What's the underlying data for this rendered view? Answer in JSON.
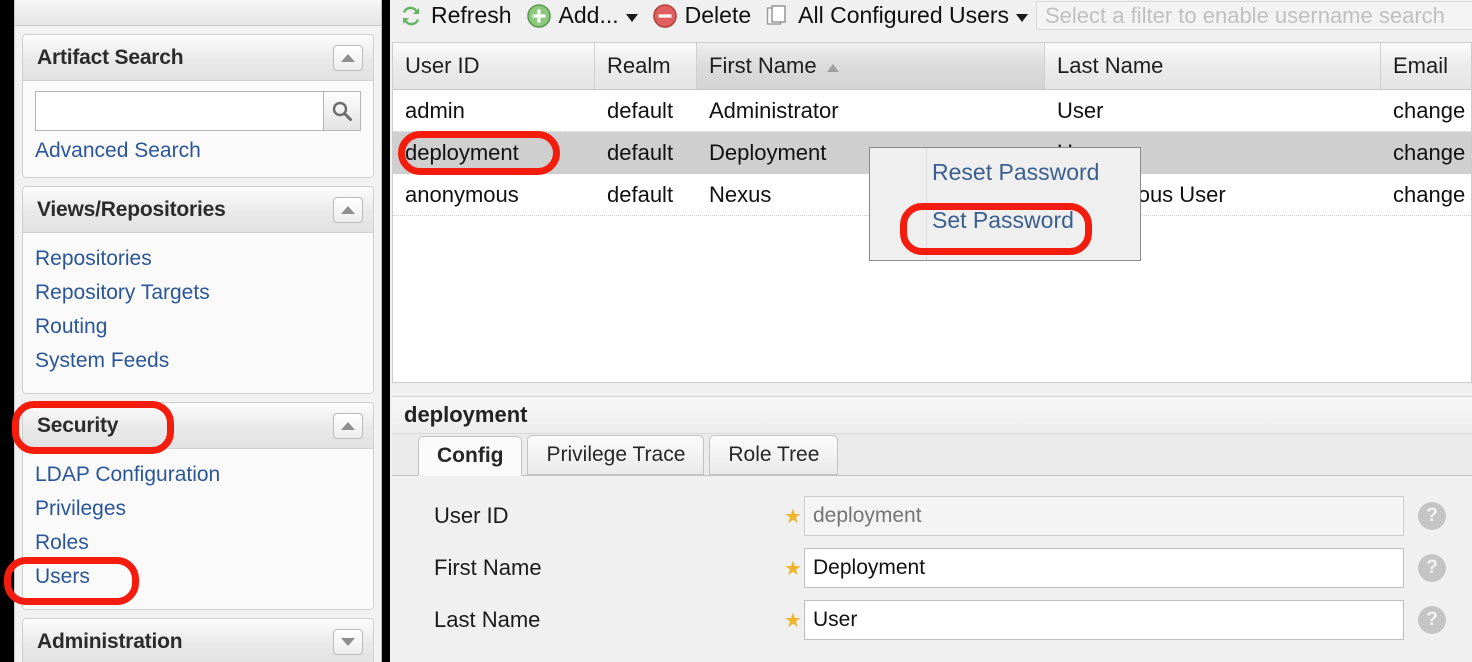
{
  "sidebar": {
    "panels": [
      {
        "title": "Artifact Search",
        "toggle_icon": "chevron-up-icon",
        "search_value": "",
        "search_placeholder": "",
        "search_icon": "magnifier-icon",
        "advanced_link": "Advanced Search"
      },
      {
        "title": "Views/Repositories",
        "toggle_icon": "chevron-up-icon",
        "links": [
          "Repositories",
          "Repository Targets",
          "Routing",
          "System Feeds"
        ]
      },
      {
        "title": "Security",
        "toggle_icon": "chevron-up-icon",
        "links": [
          "LDAP Configuration",
          "Privileges",
          "Roles",
          "Users"
        ]
      },
      {
        "title": "Administration",
        "toggle_icon": "chevron-down-icon",
        "links": []
      }
    ]
  },
  "toolbar": {
    "refresh_label": "Refresh",
    "refresh_icon": "refresh-icon",
    "add_label": "Add...",
    "add_icon": "add-circle-icon",
    "add_caret_icon": "caret-down-icon",
    "delete_label": "Delete",
    "delete_icon": "delete-circle-icon",
    "filter_label": "All Configured Users",
    "filter_icon": "pages-icon",
    "filter_caret_icon": "caret-down-icon",
    "search_value": "",
    "search_placeholder": "Select a filter to enable username search"
  },
  "grid": {
    "columns": [
      {
        "label": "User ID",
        "sorted": false
      },
      {
        "label": "Realm",
        "sorted": false
      },
      {
        "label": "First Name",
        "sorted": true,
        "sort_icon": "sort-asc-icon"
      },
      {
        "label": "Last Name",
        "sorted": false
      },
      {
        "label": "Email",
        "sorted": false
      }
    ],
    "rows": [
      {
        "user_id": "admin",
        "realm": "default",
        "first_name": "Administrator",
        "last_name": "User",
        "email": "change",
        "selected": false
      },
      {
        "user_id": "deployment",
        "realm": "default",
        "first_name": "Deployment",
        "last_name": "User",
        "email": "change",
        "selected": true
      },
      {
        "user_id": "anonymous",
        "realm": "default",
        "first_name": "Nexus",
        "last_name": "Anonymous User",
        "email": "change",
        "selected": false
      }
    ]
  },
  "context_menu": {
    "items": [
      "Reset Password",
      "Set Password"
    ]
  },
  "detail": {
    "title": "deployment",
    "tabs": [
      {
        "label": "Config",
        "active": true
      },
      {
        "label": "Privilege Trace",
        "active": false
      },
      {
        "label": "Role Tree",
        "active": false
      }
    ],
    "fields": [
      {
        "label": "User ID",
        "value": "",
        "placeholder": "deployment",
        "required": true,
        "disabled": true,
        "help_icon": "help-circle-icon"
      },
      {
        "label": "First Name",
        "value": "Deployment",
        "placeholder": "",
        "required": true,
        "disabled": false,
        "help_icon": "help-circle-icon"
      },
      {
        "label": "Last Name",
        "value": "User",
        "placeholder": "",
        "required": true,
        "disabled": false,
        "help_icon": "help-circle-icon"
      }
    ]
  },
  "annotations": {
    "highlight_color": "#f41c0c",
    "targets": [
      "Security",
      "Users",
      "deployment",
      "Set Password"
    ]
  }
}
